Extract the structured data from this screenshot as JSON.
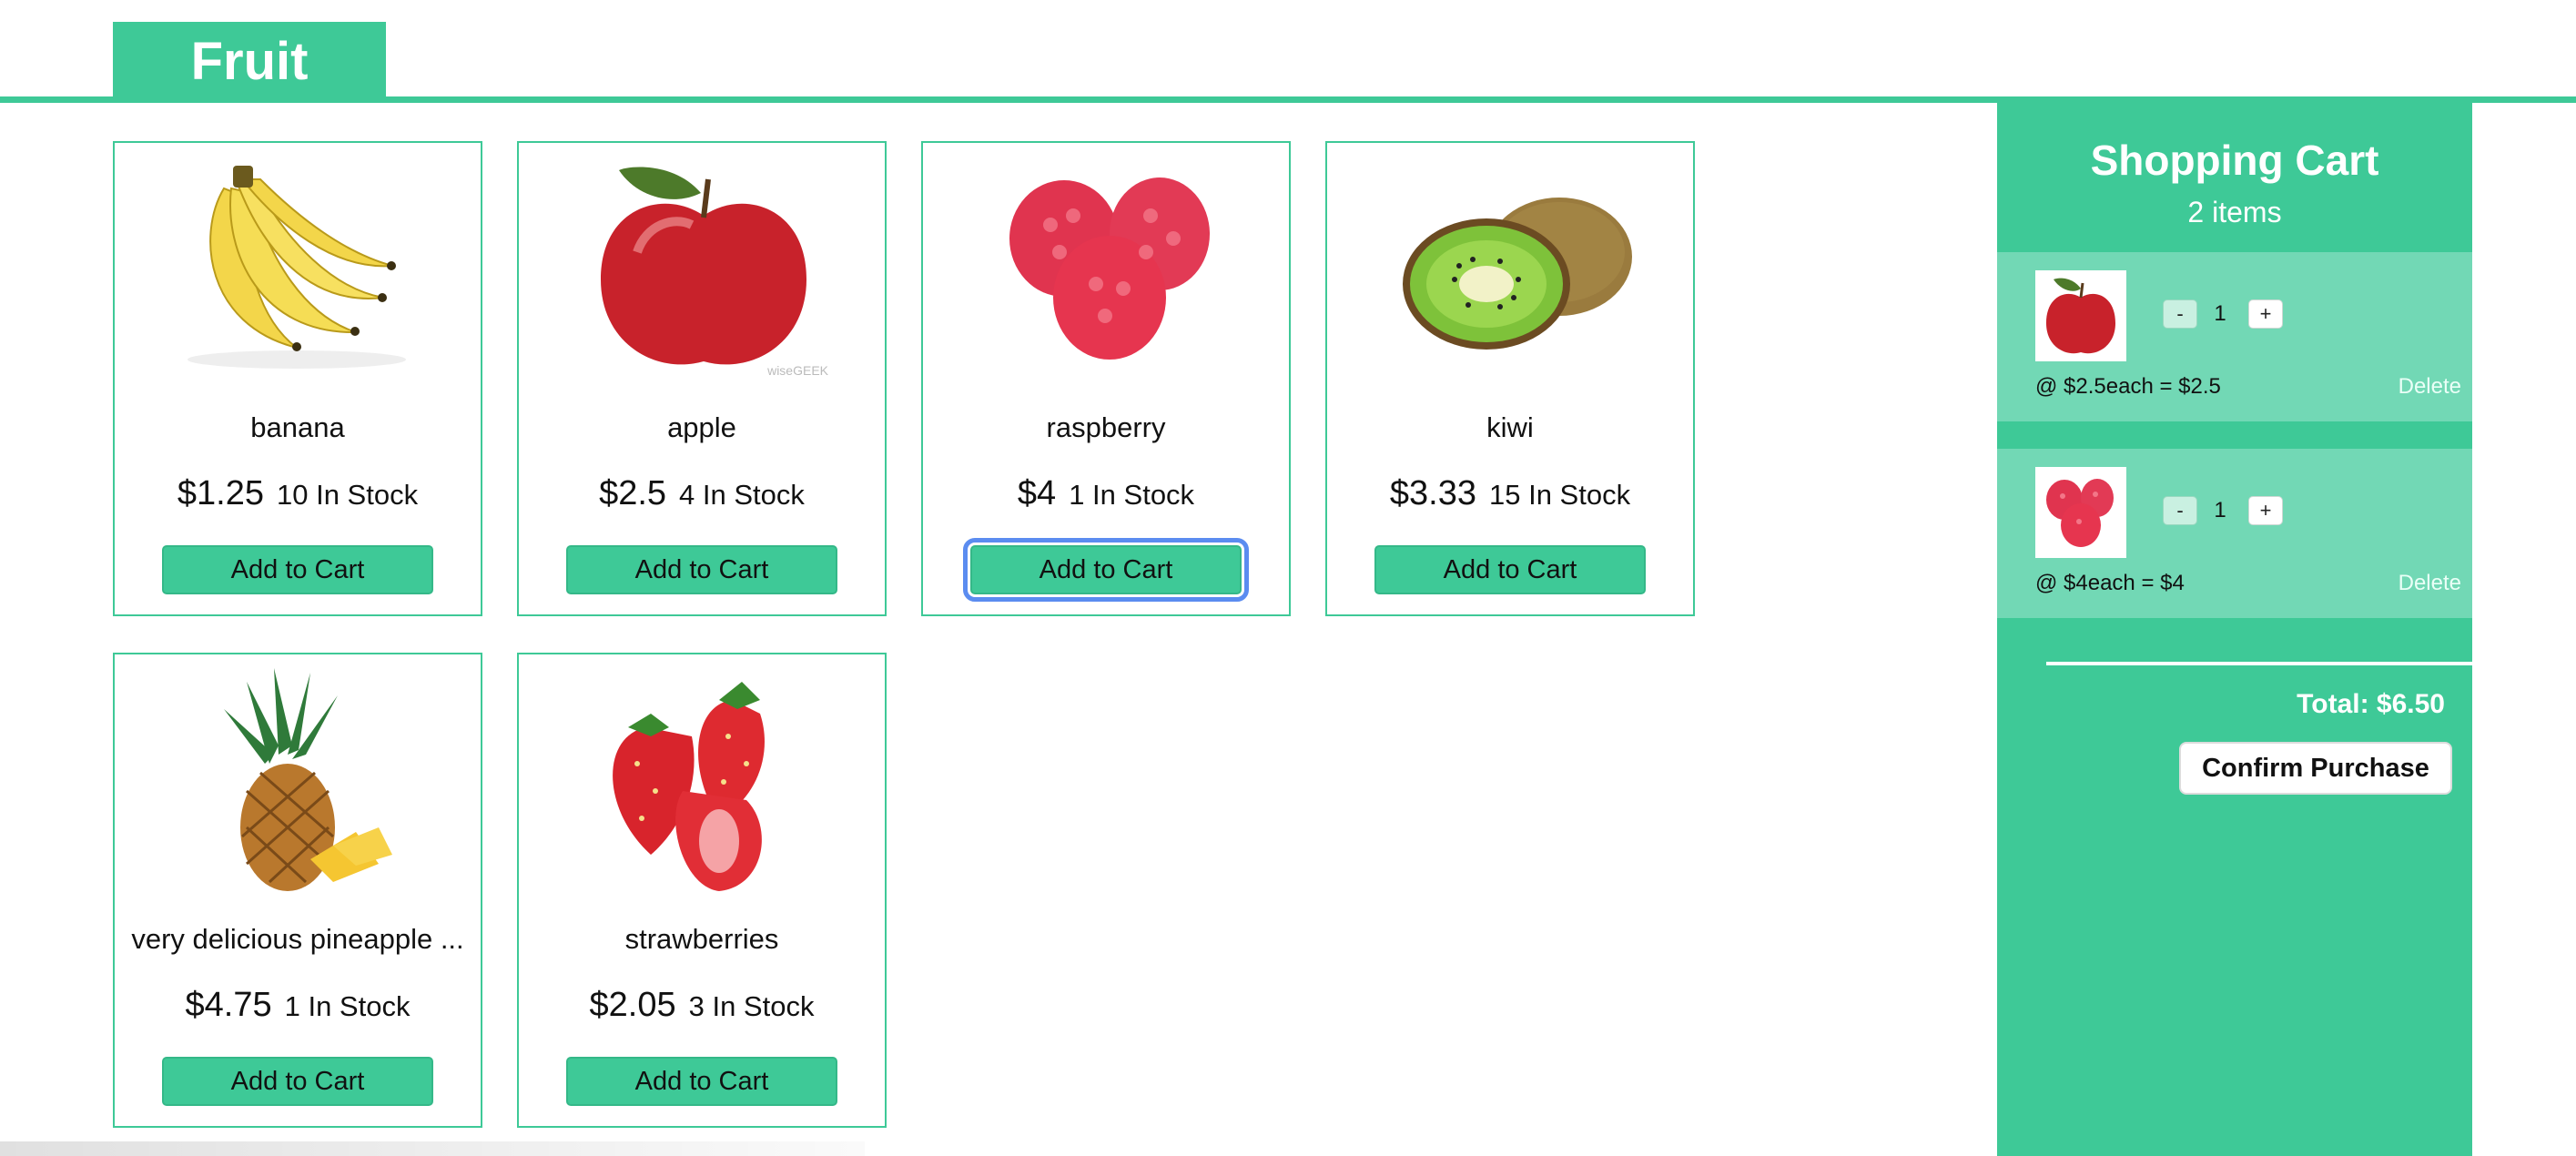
{
  "header": {
    "title": "Fruit",
    "accent_color": "#3ec997"
  },
  "products": [
    {
      "name": "banana",
      "price": "$1.25",
      "stock": "10 In Stock",
      "button": "Add to Cart",
      "image": "banana-image"
    },
    {
      "name": "apple",
      "price": "$2.5",
      "stock": "4 In Stock",
      "button": "Add to Cart",
      "image": "apple-image",
      "watermark": "wiseGEEK"
    },
    {
      "name": "raspberry",
      "price": "$4",
      "stock": "1 In Stock",
      "button": "Add to Cart",
      "image": "raspberry-image",
      "focused": true
    },
    {
      "name": "kiwi",
      "price": "$3.33",
      "stock": "15 In Stock",
      "button": "Add to Cart",
      "image": "kiwi-image"
    },
    {
      "name": "very delicious pineapple ...",
      "price": "$4.75",
      "stock": "1 In Stock",
      "button": "Add to Cart",
      "image": "pineapple-image"
    },
    {
      "name": "strawberries",
      "price": "$2.05",
      "stock": "3 In Stock",
      "button": "Add to Cart",
      "image": "strawberries-image"
    }
  ],
  "cart": {
    "title": "Shopping Cart",
    "count": "2 items",
    "items": [
      {
        "image": "apple-image",
        "qty": "1",
        "minus": "-",
        "plus": "+",
        "line": "@ $2.5each = $2.5",
        "delete": "Delete"
      },
      {
        "image": "raspberry-image",
        "qty": "1",
        "minus": "-",
        "plus": "+",
        "line": "@ $4each = $4",
        "delete": "Delete"
      }
    ],
    "total": "Total: $6.50",
    "confirm": "Confirm Purchase"
  }
}
